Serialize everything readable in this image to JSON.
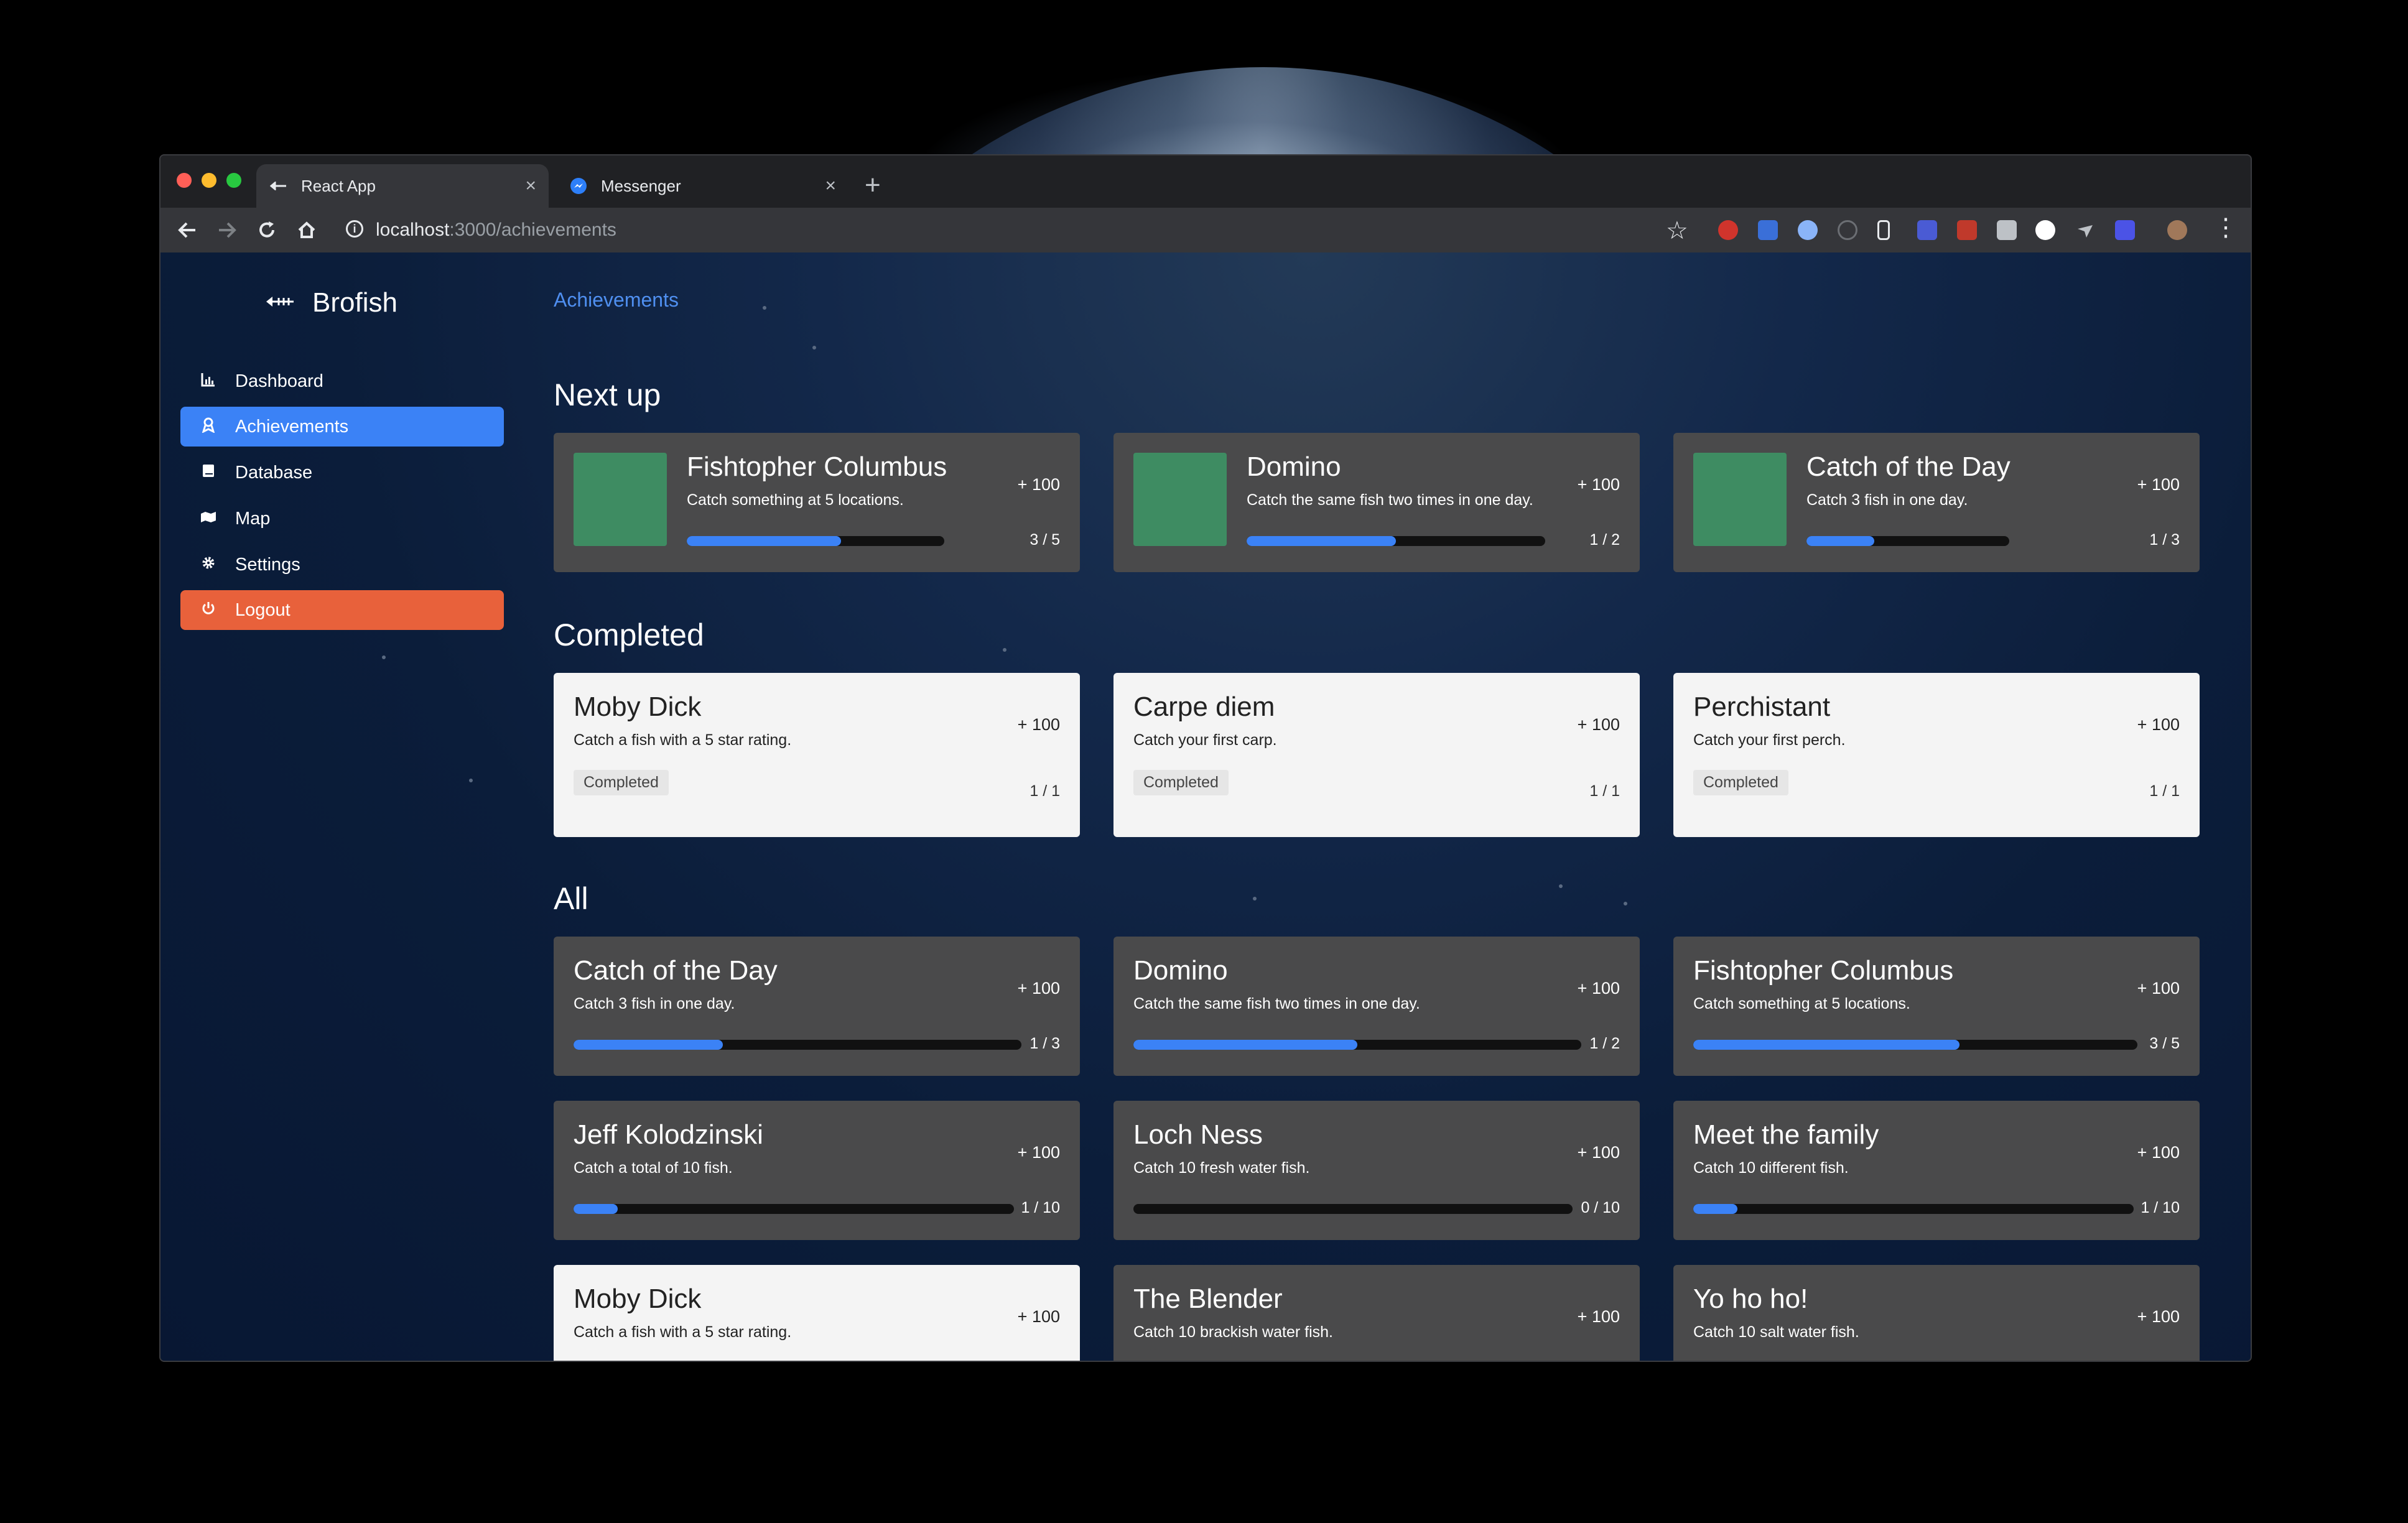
{
  "browser": {
    "tabs": [
      {
        "label": "React App",
        "favicon": "fish-icon"
      },
      {
        "label": "Messenger",
        "favicon": "messenger-icon"
      }
    ],
    "new_tab_glyph": "+",
    "close_glyph": "×",
    "url_host": "localhost",
    "url_path": ":3000/achievements"
  },
  "app": {
    "brand": "Brofish",
    "nav": [
      {
        "label": "Dashboard",
        "icon": "chart-icon"
      },
      {
        "label": "Achievements",
        "icon": "medal-icon"
      },
      {
        "label": "Database",
        "icon": "book-icon"
      },
      {
        "label": "Map",
        "icon": "map-icon"
      },
      {
        "label": "Settings",
        "icon": "gear-icon"
      },
      {
        "label": "Logout",
        "icon": "power-icon"
      }
    ],
    "breadcrumb": "Achievements",
    "sections": {
      "next_up": "Next up",
      "completed": "Completed",
      "all": "All"
    },
    "next_up": [
      {
        "title": "Fishtopher Columbus",
        "desc": "Catch something at 5 locations.",
        "points": "+ 100",
        "count": "3 / 5",
        "progress": 0.6
      },
      {
        "title": "Domino",
        "desc": "Catch the same fish two times in one day.",
        "points": "+ 100",
        "count": "1 / 2",
        "progress": 0.5
      },
      {
        "title": "Catch of the Day",
        "desc": "Catch 3 fish in one day.",
        "points": "+ 100",
        "count": "1 / 3",
        "progress": 0.333
      }
    ],
    "completed": [
      {
        "title": "Moby Dick",
        "desc": "Catch a fish with a 5 star rating.",
        "points": "+ 100",
        "badge": "Completed",
        "count": "1 / 1"
      },
      {
        "title": "Carpe diem",
        "desc": "Catch your first carp.",
        "points": "+ 100",
        "badge": "Completed",
        "count": "1 / 1"
      },
      {
        "title": "Perchistant",
        "desc": "Catch your first perch.",
        "points": "+ 100",
        "badge": "Completed",
        "count": "1 / 1"
      }
    ],
    "all": [
      {
        "title": "Catch of the Day",
        "desc": "Catch 3 fish in one day.",
        "points": "+ 100",
        "count": "1 / 3",
        "progress": 0.333
      },
      {
        "title": "Domino",
        "desc": "Catch the same fish two times in one day.",
        "points": "+ 100",
        "count": "1 / 2",
        "progress": 0.5
      },
      {
        "title": "Fishtopher Columbus",
        "desc": "Catch something at 5 locations.",
        "points": "+ 100",
        "count": "3 / 5",
        "progress": 0.6
      },
      {
        "title": "Jeff Kolodzinski",
        "desc": "Catch a total of 10 fish.",
        "points": "+ 100",
        "count": "1 / 10",
        "progress": 0.1
      },
      {
        "title": "Loch Ness",
        "desc": "Catch 10 fresh water fish.",
        "points": "+ 100",
        "count": "0 / 10",
        "progress": 0.0
      },
      {
        "title": "Meet the family",
        "desc": "Catch 10 different fish.",
        "points": "+ 100",
        "count": "1 / 10",
        "progress": 0.1
      },
      {
        "title": "Moby Dick",
        "desc": "Catch a fish with a 5 star rating.",
        "points": "+ 100"
      },
      {
        "title": "The Blender",
        "desc": "Catch 10 brackish water fish.",
        "points": "+ 100"
      },
      {
        "title": "Yo ho ho!",
        "desc": "Catch 10 salt water fish.",
        "points": "+ 100"
      }
    ]
  }
}
